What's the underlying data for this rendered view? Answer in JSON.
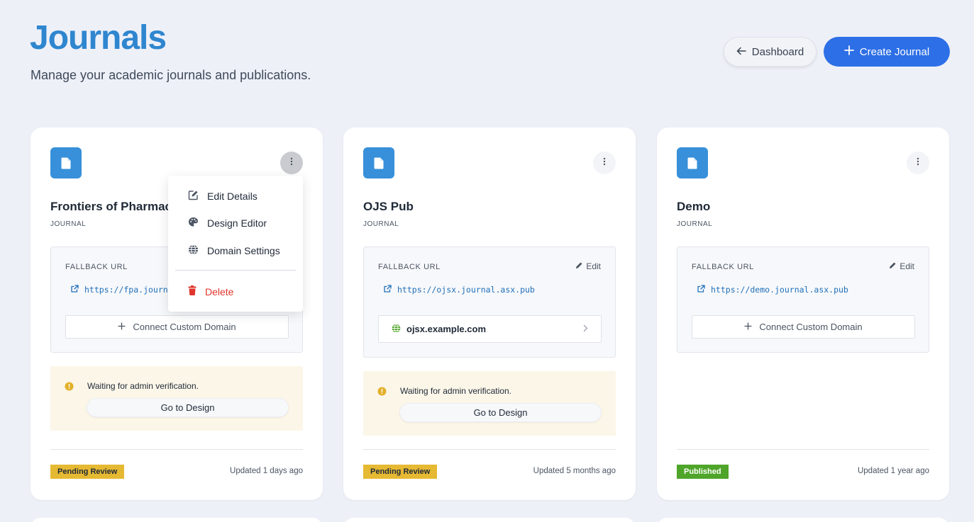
{
  "header": {
    "title": "Journals",
    "subtitle": "Manage your academic journals and publications.",
    "dashboard_label": "Dashboard",
    "create_label": "Create Journal"
  },
  "journals": [
    {
      "name": "Frontiers of Pharmac",
      "type": "JOURNAL",
      "fallback_label": "FALLBACK URL",
      "fallback_url": "https://fpa.journa",
      "connect_label": "Connect Custom Domain",
      "notice": "Waiting for admin verification.",
      "go_design": "Go to Design",
      "status": "Pending Review",
      "updated": "Updated 1 days ago"
    },
    {
      "name": "OJS Pub",
      "type": "JOURNAL",
      "fallback_label": "FALLBACK URL",
      "edit_label": "Edit",
      "fallback_url": "https://ojsx.journal.asx.pub",
      "custom_domain": "ojsx.example.com",
      "notice": "Waiting for admin verification.",
      "go_design": "Go to Design",
      "status": "Pending Review",
      "updated": "Updated 5 months ago"
    },
    {
      "name": "Demo",
      "type": "JOURNAL",
      "fallback_label": "FALLBACK URL",
      "edit_label": "Edit",
      "fallback_url": "https://demo.journal.asx.pub",
      "connect_label": "Connect Custom Domain",
      "status": "Published",
      "updated": "Updated 1 year ago"
    }
  ],
  "menu": {
    "edit_details": "Edit Details",
    "design_editor": "Design Editor",
    "domain_settings": "Domain Settings",
    "delete": "Delete"
  },
  "colors": {
    "accent": "#2d6fe6",
    "title": "#2f86cf",
    "pending": "#e6b933",
    "published": "#4fa52a",
    "danger": "#e0352b"
  }
}
